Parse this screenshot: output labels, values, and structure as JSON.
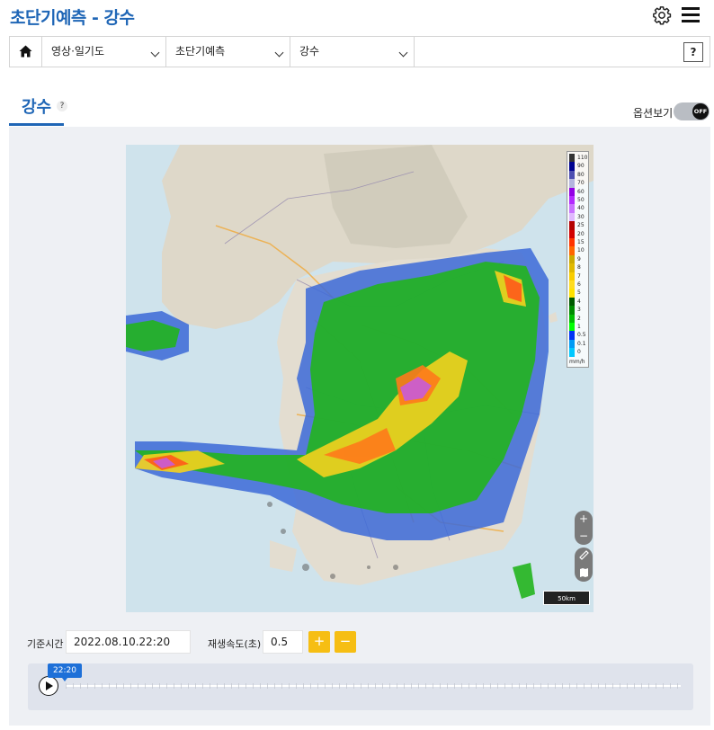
{
  "header": {
    "title": "초단기예측 - 강수"
  },
  "nav": {
    "selects": [
      {
        "label": "영상·일기도"
      },
      {
        "label": "초단기예측"
      },
      {
        "label": "강수"
      }
    ],
    "help": "?"
  },
  "tab": {
    "title": "강수",
    "help": "?"
  },
  "options": {
    "label": "옵션보기",
    "toggle": "OFF"
  },
  "legend": {
    "levels": [
      "110",
      "90",
      "80",
      "70",
      "60",
      "50",
      "40",
      "30",
      "25",
      "20",
      "15",
      "10",
      "9",
      "8",
      "7",
      "6",
      "5",
      "4",
      "3",
      "2",
      "1",
      "0.5",
      "0.1",
      "0"
    ],
    "colors": [
      "#333333",
      "#000390",
      "#4c4eb1",
      "#b3b4de",
      "#9300e4",
      "#b329ff",
      "#c971ff",
      "#e0b8ff",
      "#b40000",
      "#d20000",
      "#ff3300",
      "#ff6600",
      "#ccaa00",
      "#e0b900",
      "#f9cd00",
      "#ffdc1f",
      "#ffe100",
      "#005a00",
      "#008c00",
      "#00be00",
      "#00ff00",
      "#0033f5",
      "#009bf5",
      "#00c8ff"
    ],
    "unit": "mm/h"
  },
  "map": {
    "zoom_in": "+",
    "zoom_out": "−",
    "scale": "50km"
  },
  "controls": {
    "base_time_label": "기준시간",
    "base_time_value": "2022.08.10.22:20",
    "speed_label": "재생속도(초)",
    "speed_value": "0.5",
    "plus": "+",
    "minus": "−"
  },
  "timeline": {
    "current": "22:20"
  }
}
